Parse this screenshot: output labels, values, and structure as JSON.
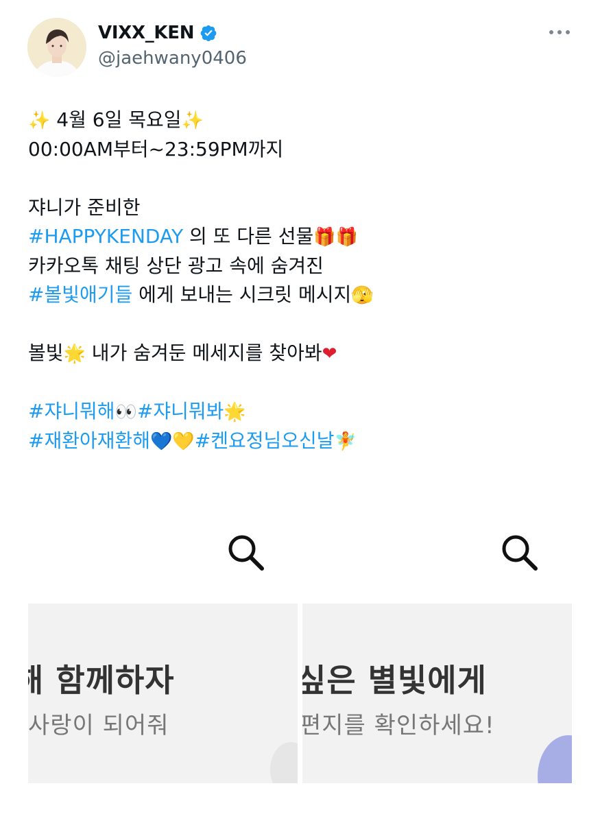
{
  "author": {
    "display_name": "VIXX_KEN",
    "handle": "@jaehwany0406",
    "verified": true,
    "avatar_icon": "profile-photo"
  },
  "menu": {
    "icon": "more-dots-icon"
  },
  "post": {
    "line1": {
      "emoji_a": "✨",
      "text": " 4월 6일 목요일",
      "emoji_b": "✨"
    },
    "line2": "00:00AM부터~23:59PM까지",
    "line3": "쟈니가 준비한",
    "line4": {
      "hashtag": "#HAPPYKENDAY",
      "text": " 의 또 다른 선물",
      "emoji": "🎁🎁"
    },
    "line5": "카카오톡 채팅 상단 광고 속에 숨겨진",
    "line6": {
      "hashtag": "#볼빛애기들",
      "text": " 에게 보내는 시크릿 메시지",
      "emoji": "🫣"
    },
    "line7": {
      "text_a": "볼빛",
      "emoji_a": "🌟",
      "text_b": " 내가 숨겨둔 메세지를 찾아봐",
      "emoji_b": "❤"
    },
    "line8": {
      "tag_a": "#쟈니뭐해",
      "emoji_a": " 👀 ",
      "tag_b": "#쟈니뭐봐",
      "emoji_b": " 🌟"
    },
    "line9": {
      "tag_a": "#재환아재환해",
      "emoji_a": "💙",
      "emoji_b": " 💛 ",
      "tag_b": "#켄요정님오신날",
      "emoji_c": "🧚"
    }
  },
  "media": [
    {
      "headline": "해 함께하자",
      "subline": "사랑이 되어줘",
      "icon": "search-icon"
    },
    {
      "headline": "싶은 별빛에게",
      "subline": "편지를 확인하세요!",
      "icon": "search-icon"
    }
  ],
  "colors": {
    "hashtag": "#1d9bf0",
    "verified_badge": "#1d9bf0",
    "handle": "#536471",
    "media_bg": "#f2f2f2"
  }
}
